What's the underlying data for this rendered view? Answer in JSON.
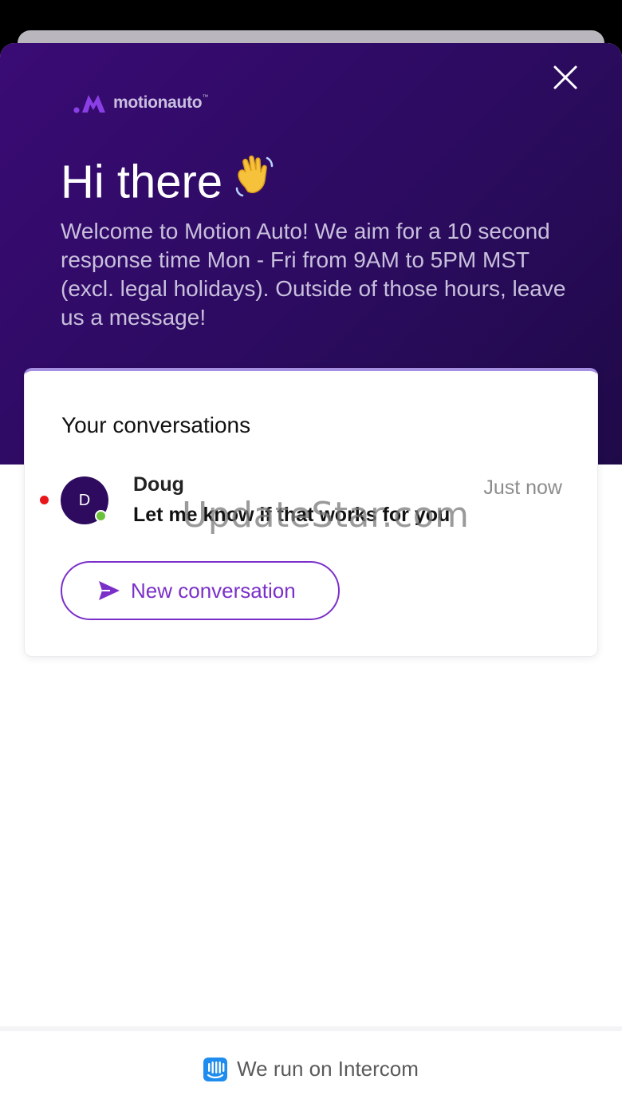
{
  "brand": {
    "logo_text": "motionauto",
    "logo_tm": "™",
    "accent": "#7b2fc9",
    "hero_color": "#2b0b5f"
  },
  "header": {
    "greeting": "Hi there",
    "wave_emoji": "👋",
    "welcome_message": "Welcome to Motion Auto! We aim for a 10 second response time Mon - Fri from 9AM to 5PM MST (excl. legal holidays). Outside of those hours, leave us a message!",
    "close_icon": "close-icon"
  },
  "conversations": {
    "title": "Your conversations",
    "items": [
      {
        "avatar_initial": "D",
        "name": "Doug",
        "time": "Just now",
        "preview": "Let me know if that works for you",
        "unread": true,
        "online": true
      }
    ],
    "new_button_label": "New conversation",
    "new_button_icon": "send-icon"
  },
  "watermark": "UpdateStar.com",
  "footer": {
    "label": "We run on Intercom",
    "icon": "intercom-icon"
  }
}
